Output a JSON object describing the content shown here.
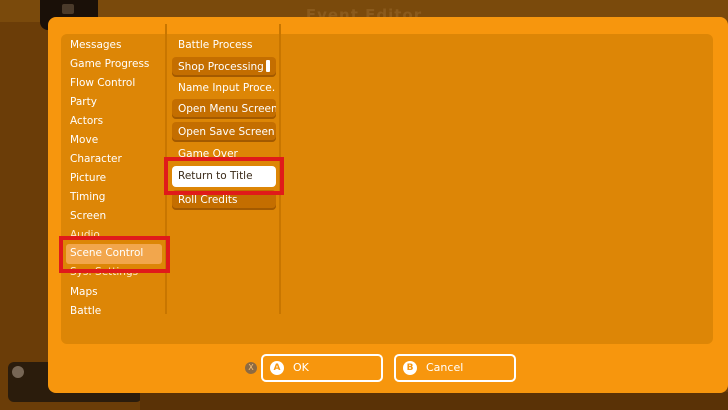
{
  "background": {
    "title": "Event Editor"
  },
  "categories": [
    {
      "label": "Messages"
    },
    {
      "label": "Game Progress"
    },
    {
      "label": "Flow Control"
    },
    {
      "label": "Party"
    },
    {
      "label": "Actors"
    },
    {
      "label": "Move"
    },
    {
      "label": "Character"
    },
    {
      "label": "Picture"
    },
    {
      "label": "Timing"
    },
    {
      "label": "Screen"
    },
    {
      "label": "Audio"
    },
    {
      "label": "Scene Control",
      "selected": true
    },
    {
      "label": "Sys. Settings"
    },
    {
      "label": "Maps"
    },
    {
      "label": "Battle"
    }
  ],
  "commands": [
    {
      "label": "Battle Process",
      "style": "plain"
    },
    {
      "label": "Shop Processing",
      "style": "button"
    },
    {
      "label": "Name Input Proce…",
      "style": "plain"
    },
    {
      "label": "Open Menu Screen",
      "style": "button"
    },
    {
      "label": "Open Save Screen",
      "style": "button"
    },
    {
      "label": "Game Over",
      "style": "plain"
    },
    {
      "label": "Return to Title",
      "style": "focused"
    },
    {
      "label": "Roll Credits",
      "style": "button"
    }
  ],
  "footer": {
    "x_badge": "X",
    "ok_badge": "A",
    "ok_label": "OK",
    "cancel_badge": "B",
    "cancel_label": "Cancel"
  },
  "colors": {
    "dialog": "#f7960d",
    "panel": "#dd8606",
    "highlight": "#e01a1a",
    "selected_category": "#f2a64c"
  }
}
